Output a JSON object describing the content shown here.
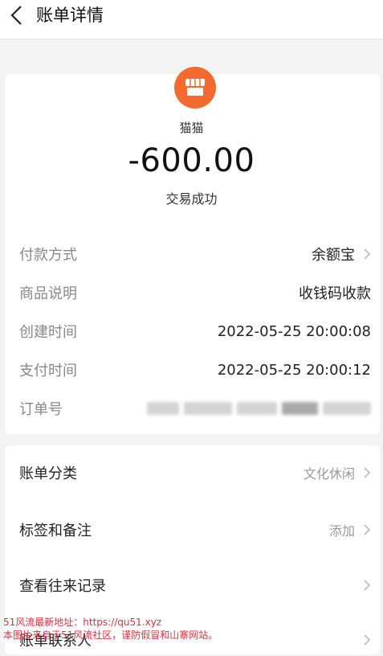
{
  "header": {
    "title": "账单详情"
  },
  "merchant": {
    "name": "猫猫",
    "icon": "store-icon",
    "icon_color": "#f26a2d"
  },
  "transaction": {
    "amount": "-600.00",
    "status": "交易成功"
  },
  "details": [
    {
      "label": "付款方式",
      "value": "余额宝"
    },
    {
      "label": "商品说明",
      "value": "收钱码收款"
    },
    {
      "label": "创建时间",
      "value": "2022-05-25 20:00:08"
    },
    {
      "label": "支付时间",
      "value": "2022-05-25 20:00:12"
    },
    {
      "label": "订单号",
      "value": ""
    }
  ],
  "menu": [
    {
      "label": "账单分类",
      "value": "文化休闲"
    },
    {
      "label": "标签和备注",
      "value": "添加"
    },
    {
      "label": "查看往来记录",
      "value": ""
    },
    {
      "label": "账单联系人",
      "value": ""
    }
  ],
  "watermark": {
    "line1": "51风流最新地址：https://qu51.xyz",
    "line2": "本图片来自于51风流社区，谨防假冒和山寨网站。"
  }
}
